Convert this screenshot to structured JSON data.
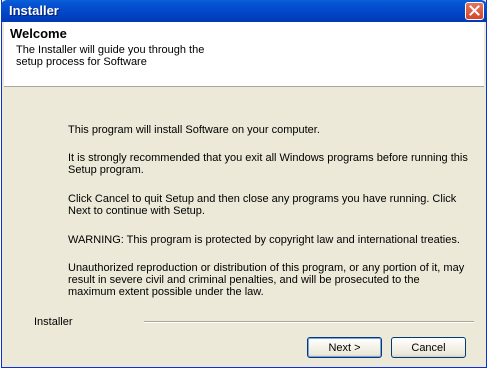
{
  "window": {
    "title": "Installer"
  },
  "header": {
    "title": "Welcome",
    "description": "The Installer will guide you through the setup process for Software"
  },
  "body": {
    "paragraphs": [
      "This program will install Software on your computer.",
      "It is strongly recommended that you exit all Windows programs before running this Setup program.",
      "Click Cancel to quit Setup and then close any programs you have running. Click Next to continue with Setup.",
      "WARNING: This program is protected by copyright law and international treaties.",
      "Unauthorized reproduction or distribution of this program, or any portion of it, may result in severe civil and criminal penalties, and will be prosecuted to the maximum extent possible under the law."
    ]
  },
  "footer": {
    "label": "Installer",
    "next_label": "Next >",
    "cancel_label": "Cancel"
  },
  "colors": {
    "titlebar": "#0145c6",
    "close_button": "#d3462b",
    "dialog_background": "#ece9d8"
  },
  "icons": {
    "close": "close-icon"
  }
}
